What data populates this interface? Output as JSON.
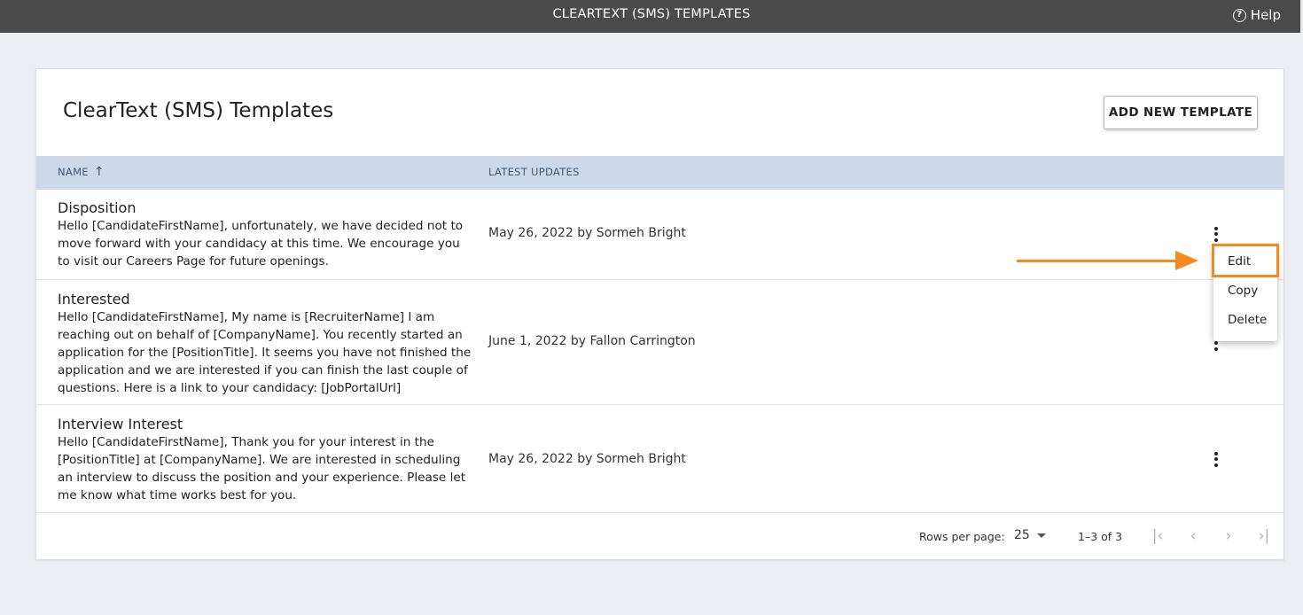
{
  "topbar": {
    "title": "CLEARTEXT (SMS) TEMPLATES",
    "help_label": "Help",
    "help_icon": "question-circle-icon"
  },
  "page": {
    "title": "ClearText (SMS) Templates",
    "add_button_label": "ADD NEW TEMPLATE"
  },
  "table": {
    "columns": {
      "name": "NAME",
      "latest_updates": "LATEST UPDATES",
      "sort_icon": "arrow-up-icon"
    },
    "rows": [
      {
        "title": "Disposition",
        "body": "Hello [CandidateFirstName], unfortunately, we have decided not to move forward with your candidacy at this time. We encourage you to visit our Careers Page for future openings.",
        "updated": "May 26, 2022 by Sormeh Bright"
      },
      {
        "title": "Interested",
        "body": "Hello [CandidateFirstName], My name is [RecruiterName] I am reaching out on behalf of [CompanyName]. You recently started an application for the [PositionTitle]. It seems you have not finished the application and we are interested if you can finish the last couple of questions. Here is a link to your candidacy: [JobPortalUrl]",
        "updated": "June 1, 2022 by Fallon Carrington"
      },
      {
        "title": "Interview Interest",
        "body": "Hello [CandidateFirstName], Thank you for your interest in the [PositionTitle] at [CompanyName]. We are interested in scheduling an interview to discuss the position and your experience. Please let me know what time works best for you.",
        "updated": "May 26, 2022 by Sormeh Bright"
      }
    ]
  },
  "pagination": {
    "rows_per_page_label": "Rows per page:",
    "rows_per_page_value": "25",
    "range_label": "1–3 of 3",
    "first_icon": "first-page-icon",
    "prev_icon": "chevron-left-icon",
    "next_icon": "chevron-right-icon",
    "last_icon": "last-page-icon"
  },
  "context_menu": {
    "items": [
      "Edit",
      "Copy",
      "Delete"
    ]
  },
  "annotation": {
    "color": "#f58a1f"
  }
}
